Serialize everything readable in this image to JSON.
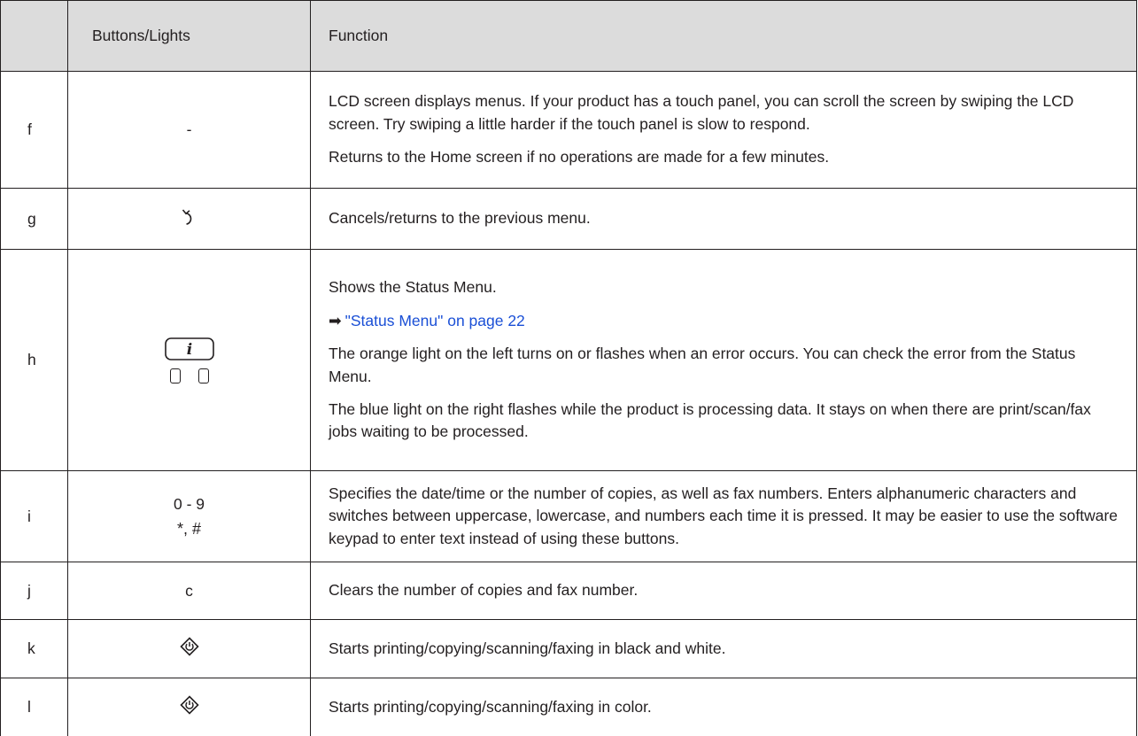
{
  "table": {
    "headers": [
      "",
      "Buttons/Lights",
      "Function"
    ],
    "rows": [
      {
        "key": "f",
        "button": "-",
        "function": [
          "LCD screen displays menus. If your product has a touch panel, you can scroll the screen by swiping the LCD screen. Try swiping a little harder if the touch panel is slow to respond.",
          "Returns to the Home screen if no operations are made for a few minutes."
        ]
      },
      {
        "key": "g",
        "button_icon": "back-arrow-icon",
        "function": [
          "Cancels/returns to the previous menu."
        ]
      },
      {
        "key": "h",
        "button_icon": "info-button-icon",
        "function": [
          "Shows the Status Menu.",
          "\"Status Menu\" on page 22",
          "The orange light on the left turns on or flashes when an error occurs. You can check the error from the Status Menu.",
          "The blue light on the right flashes while the product is processing data. It stays on when there are print/scan/fax jobs waiting to be processed."
        ],
        "link_arrow": "➡"
      },
      {
        "key": "i",
        "button_line1": "0 - 9",
        "button_line2": "*, #",
        "function": [
          "Specifies the date/time or the number of copies, as well as fax numbers. Enters alphanumeric characters and switches between uppercase, lowercase, and numbers each time it is pressed. It may be easier to use the software keypad to enter text instead of using these buttons."
        ]
      },
      {
        "key": "j",
        "button": "c",
        "function": [
          "Clears the number of copies and fax number."
        ]
      },
      {
        "key": "k",
        "button_icon": "start-diamond-icon",
        "function": [
          "Starts printing/copying/scanning/faxing in black and white."
        ]
      },
      {
        "key": "l",
        "button_icon": "start-diamond-icon",
        "function": [
          "Starts printing/copying/scanning/faxing in color."
        ]
      }
    ]
  },
  "colors": {
    "header_bg": "#dcdcdc",
    "text": "#231f20",
    "link": "#1a4fd6"
  }
}
